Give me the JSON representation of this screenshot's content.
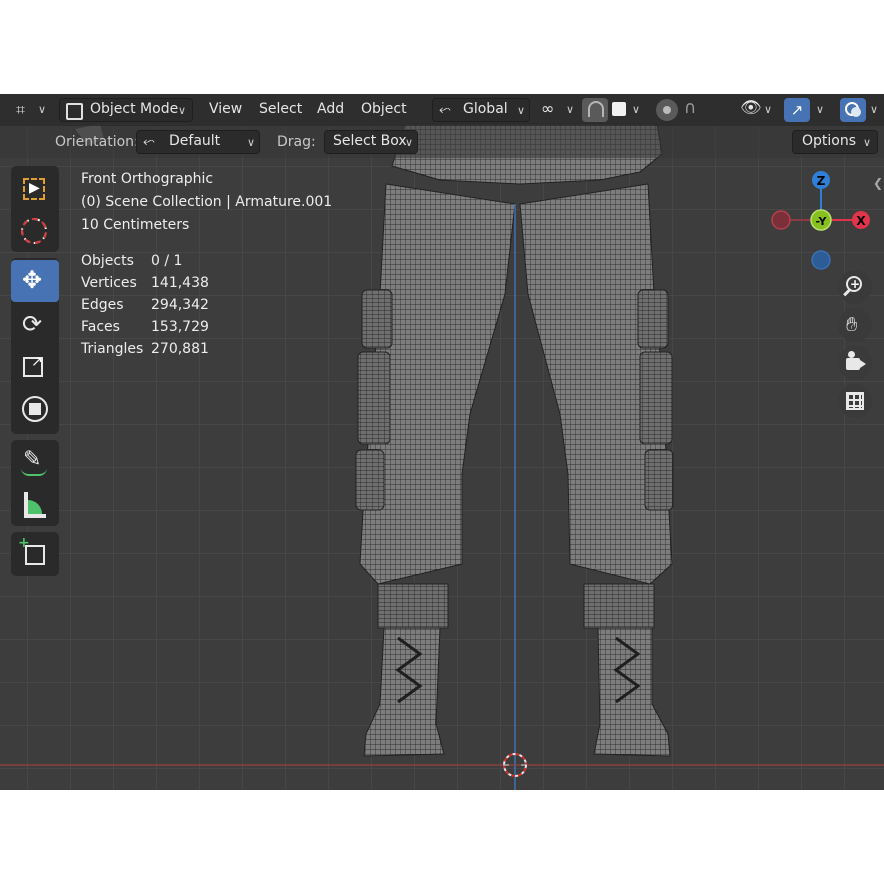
{
  "header": {
    "mode_label": "Object Mode",
    "menus": [
      "View",
      "Select",
      "Add",
      "Object"
    ],
    "transform_orientation": "Global",
    "menu_icon": "editor-type-icon"
  },
  "subheader": {
    "orientation_label": "Orientation:",
    "orientation_value": "Default",
    "drag_label": "Drag:",
    "drag_value": "Select Box",
    "options_label": "Options"
  },
  "overlay": {
    "view_name": "Front Orthographic",
    "collection": "(0) Scene Collection | Armature.001",
    "scale": "10 Centimeters",
    "stats": [
      {
        "label": "Objects",
        "value": "0 / 1"
      },
      {
        "label": "Vertices",
        "value": "141,438"
      },
      {
        "label": "Edges",
        "value": "294,342"
      },
      {
        "label": "Faces",
        "value": "153,729"
      },
      {
        "label": "Triangles",
        "value": "270,881"
      }
    ]
  },
  "toolbar": {
    "tools": [
      "select-box-icon",
      "cursor-icon",
      "move-icon",
      "rotate-icon",
      "scale-icon",
      "transform-icon",
      "annotate-icon",
      "measure-icon",
      "add-cube-icon"
    ],
    "active": "move-icon"
  },
  "gizmo": {
    "axes": [
      "Z",
      "-Y",
      "X"
    ],
    "colors": {
      "x": "#e0344a",
      "y": "#86c01f",
      "z": "#2f7fd6"
    }
  },
  "nav_buttons": [
    "zoom-icon",
    "pan-hand-icon",
    "camera-icon",
    "grid-icon"
  ],
  "colors": {
    "accent": "#4772b3",
    "grid": "#474747",
    "bg": "#3d3d3d"
  }
}
